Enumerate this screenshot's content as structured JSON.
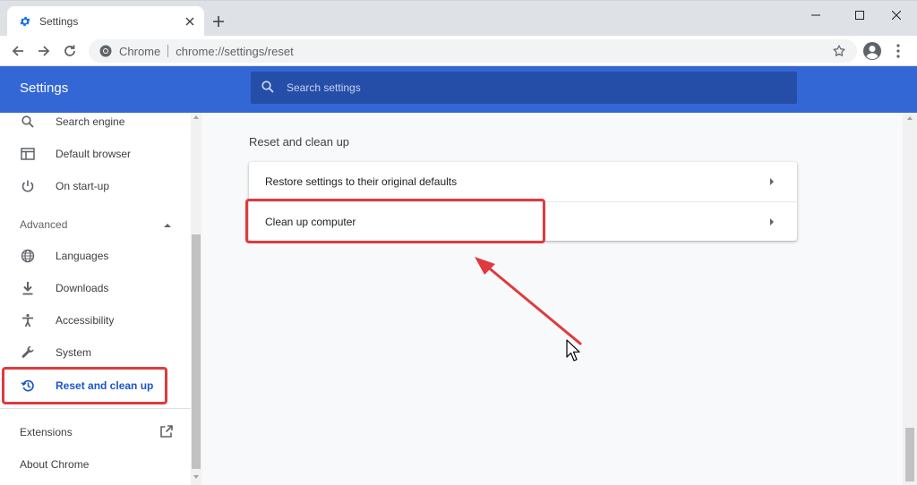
{
  "tab": {
    "title": "Settings",
    "close_icon": "close-icon",
    "favicon": "gear-icon"
  },
  "omnibox": {
    "chip_label": "Chrome",
    "url": "chrome://settings/reset"
  },
  "header": {
    "title": "Settings",
    "search_placeholder": "Search settings"
  },
  "sidebar": {
    "items": [
      {
        "label": "Search engine",
        "icon": "search-icon"
      },
      {
        "label": "Default browser",
        "icon": "browser-window-icon"
      },
      {
        "label": "On start-up",
        "icon": "power-icon"
      }
    ],
    "advanced_label": "Advanced",
    "advanced_items": [
      {
        "label": "Languages",
        "icon": "globe-icon"
      },
      {
        "label": "Downloads",
        "icon": "download-icon"
      },
      {
        "label": "Accessibility",
        "icon": "accessibility-icon"
      },
      {
        "label": "System",
        "icon": "wrench-icon"
      },
      {
        "label": "Reset and clean up",
        "icon": "restore-icon",
        "active": true
      }
    ],
    "extensions_label": "Extensions",
    "about_label": "About Chrome"
  },
  "main": {
    "section_title": "Reset and clean up",
    "rows": [
      {
        "label": "Restore settings to their original defaults"
      },
      {
        "label": "Clean up computer"
      }
    ]
  },
  "colors": {
    "accent": "#3367d6",
    "search_bg": "#254ea8",
    "active_text": "#1a56c8",
    "annotation_red": "#e03a3e"
  }
}
